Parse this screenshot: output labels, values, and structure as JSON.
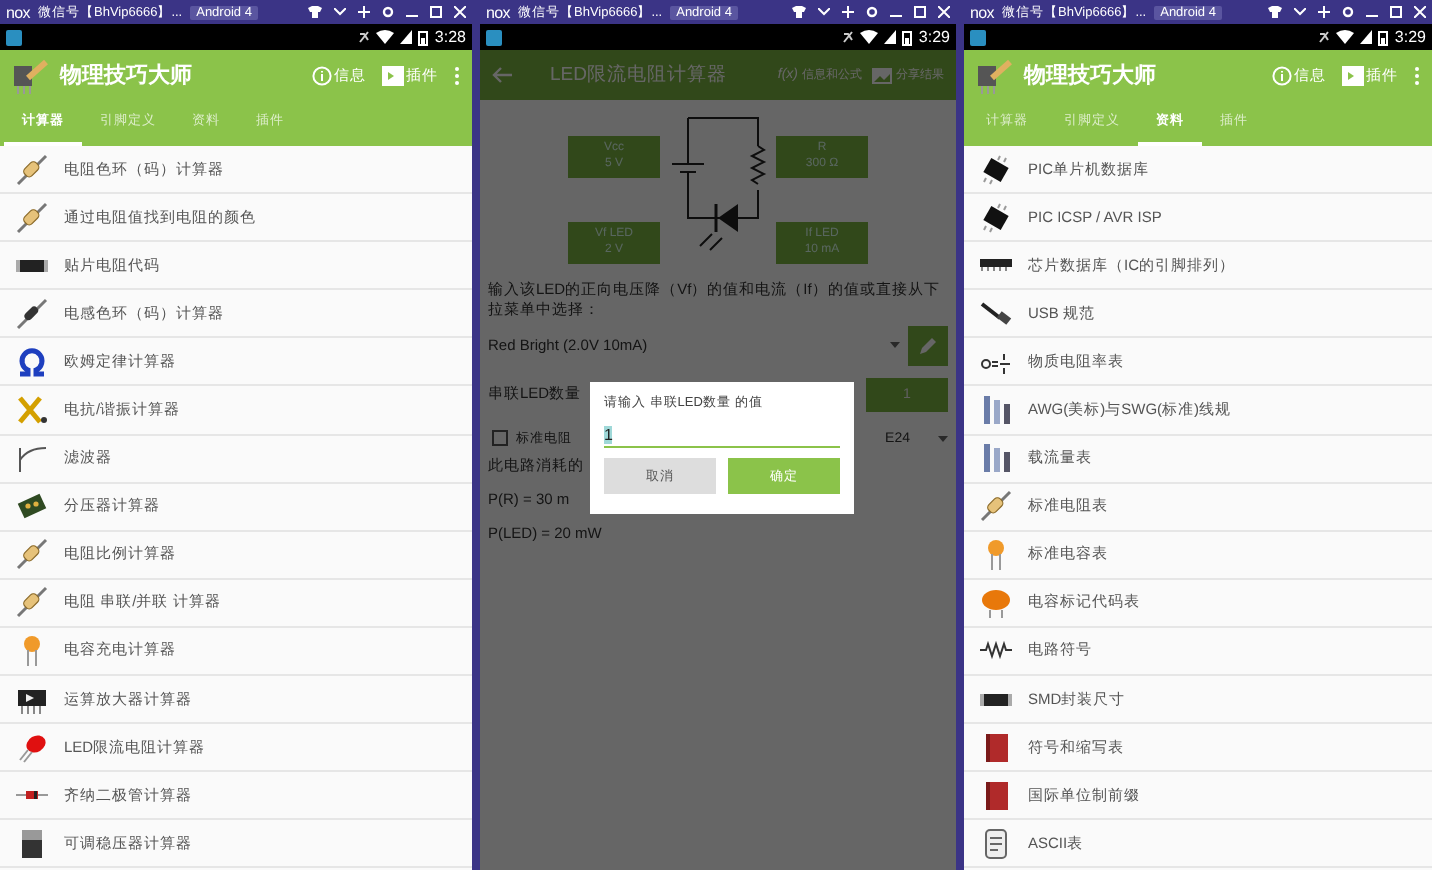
{
  "panels": [
    {
      "kind": "list",
      "emulator": {
        "logo": "nox",
        "title": "微信号【BhVip6666】...",
        "badge": "Android 4"
      },
      "time": "3:28",
      "app_title": "物理技巧大师",
      "actions": [
        "信息",
        "插件"
      ],
      "tabs": [
        {
          "label": "计算器",
          "selected": true
        },
        {
          "label": "引脚定义",
          "selected": false
        },
        {
          "label": "资料",
          "selected": false
        },
        {
          "label": "插件",
          "selected": false
        }
      ],
      "items": [
        "电阻色环（码）计算器",
        "通过电阻值找到电阻的颜色",
        "贴片电阻代码",
        "电感色环（码）计算器",
        "欧姆定律计算器",
        "电抗/谐振计算器",
        "滤波器",
        "分压器计算器",
        "电阻比例计算器",
        "电阻 串联/并联 计算器",
        "电容充电计算器",
        "运算放大器计算器",
        "LED限流电阻计算器",
        "齐纳二极管计算器",
        "可调稳压器计算器"
      ]
    },
    {
      "kind": "calculator",
      "emulator": {
        "logo": "nox",
        "title": "微信号【BhVip6666】...",
        "badge": "Android 4"
      },
      "time": "3:29",
      "title": "LED限流电阻计算器",
      "formula_action": {
        "glyph": "f(x)",
        "label": "信息和公式"
      },
      "share_action": "分享结果",
      "inputs": [
        {
          "label": "Vcc",
          "value": "5 V"
        },
        {
          "label": "R",
          "value": "300 Ω"
        },
        {
          "label": "Vf LED",
          "value": "2 V"
        },
        {
          "label": "If LED",
          "value": "10 mA"
        }
      ],
      "instructions": "输入该LED的正向电压降（Vf）的值和电流（If）的值或直接从下拉菜单中选择：",
      "preset": "Red Bright (2.0V 10mA)",
      "led_count_label": "串联LED数量",
      "led_count": "1",
      "standard_checkbox": {
        "label": "标准电阻",
        "checked": false
      },
      "series": "E24",
      "results": [
        "此电路消耗的",
        "P(R) = 30 m",
        "P(LED) = 20 mW"
      ],
      "dialog": {
        "title": "请输入 串联LED数量 的值",
        "value": "1",
        "buttons": [
          "取消",
          "确定"
        ]
      }
    },
    {
      "kind": "list",
      "emulator": {
        "logo": "nox",
        "title": "微信号【BhVip6666】...",
        "badge": "Android 4"
      },
      "time": "3:29",
      "app_title": "物理技巧大师",
      "actions": [
        "信息",
        "插件"
      ],
      "tabs": [
        {
          "label": "计算器",
          "selected": false
        },
        {
          "label": "引脚定义",
          "selected": false
        },
        {
          "label": "资料",
          "selected": true
        },
        {
          "label": "插件",
          "selected": false
        }
      ],
      "items": [
        "PIC单片机数据库",
        "PIC ICSP / AVR ISP",
        "芯片数据库（IC的引脚排列）",
        "USB 规范",
        "物质电阻率表",
        "AWG(美标)与SWG(标准)线规",
        "载流量表",
        "标准电阻表",
        "标准电容表",
        "电容标记代码表",
        "电路符号",
        "SMD封装尺寸",
        "符号和缩写表",
        "国际单位制前缀",
        "ASCII表"
      ]
    }
  ]
}
